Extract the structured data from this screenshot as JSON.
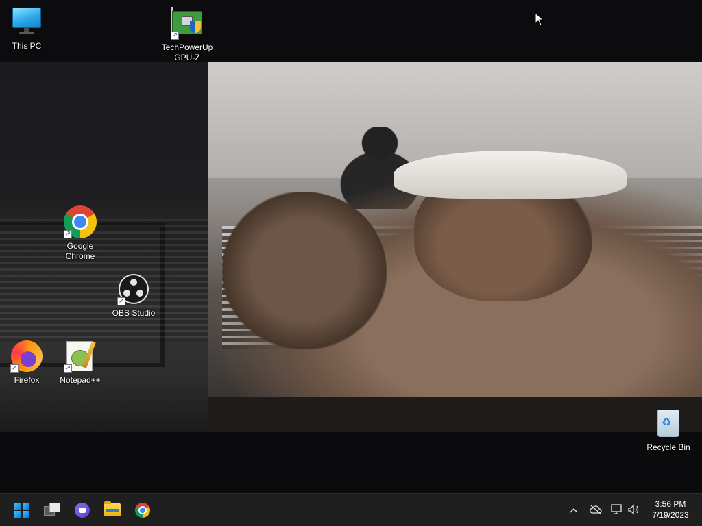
{
  "desktop": {
    "icons": {
      "this_pc": "This PC",
      "gpuz": [
        "TechPowerUp",
        "GPU-Z"
      ],
      "chrome": [
        "Google",
        "Chrome"
      ],
      "obs": "OBS Studio",
      "firefox": "Firefox",
      "notepadpp": "Notepad++",
      "recycle_bin": "Recycle Bin"
    }
  },
  "taskbar": {
    "pinned_icons": [
      "windows-start-icon",
      "task-view-icon",
      "chat-icon",
      "file-explorer-icon",
      "chrome-icon"
    ],
    "tray_icons": [
      "chevron-up-icon",
      "cloud-off-icon",
      "network-icon",
      "volume-icon"
    ],
    "clock": {
      "time": "3:56 PM",
      "date": "7/19/2023"
    }
  },
  "colors": {
    "taskbar_bg": "#1f1f1f",
    "accent": "#0078d4"
  }
}
